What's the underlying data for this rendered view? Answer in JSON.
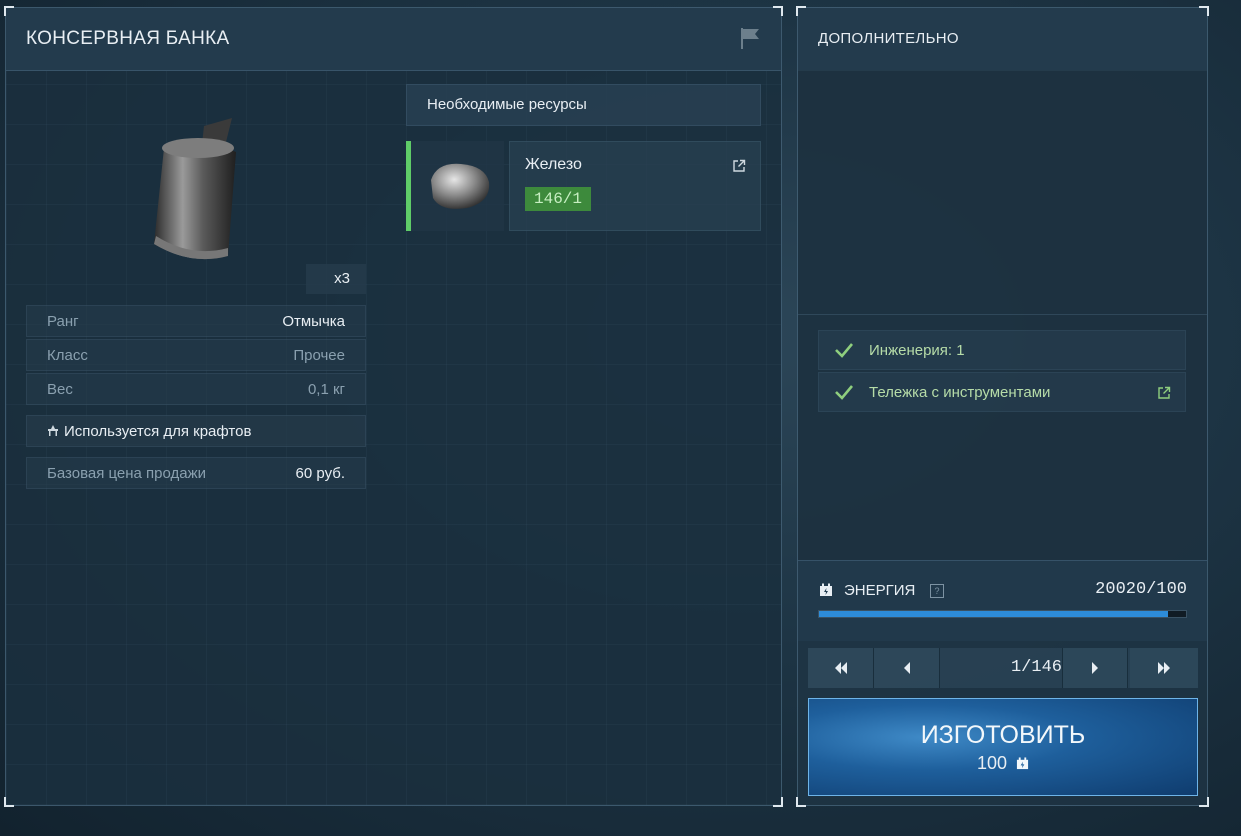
{
  "item": {
    "title": "Консервная банка",
    "quantity": "x3",
    "stats": [
      {
        "key": "Ранг",
        "value": "Отмычка"
      },
      {
        "key": "Класс",
        "value": "Прочее"
      },
      {
        "key": "Вес",
        "value": "0,1 кг"
      }
    ],
    "craft_usage": "Используется для крафтов",
    "sell_price_label": "Базовая цена продажи",
    "sell_price_value": "60 руб."
  },
  "resources": {
    "header": "Необходимые ресурсы",
    "items": [
      {
        "name": "Железо",
        "count": "146/1",
        "icon": "iron-ore-icon"
      }
    ]
  },
  "extra": {
    "title": "Дополнительно",
    "requirements": [
      {
        "label": "Инженерия: 1"
      },
      {
        "label": "Тележка с инструментами"
      }
    ]
  },
  "energy": {
    "label": "Энергия",
    "help": "?",
    "value": "20020/100",
    "fill_fraction": 0.95
  },
  "pager": {
    "indicator": "1/146"
  },
  "craft_button": {
    "label": "Изготовить",
    "cost": "100"
  },
  "colors": {
    "accent_green": "#5fcc68",
    "energy_bar": "#2d8cd9",
    "button_blue": "#1e5f9c"
  }
}
